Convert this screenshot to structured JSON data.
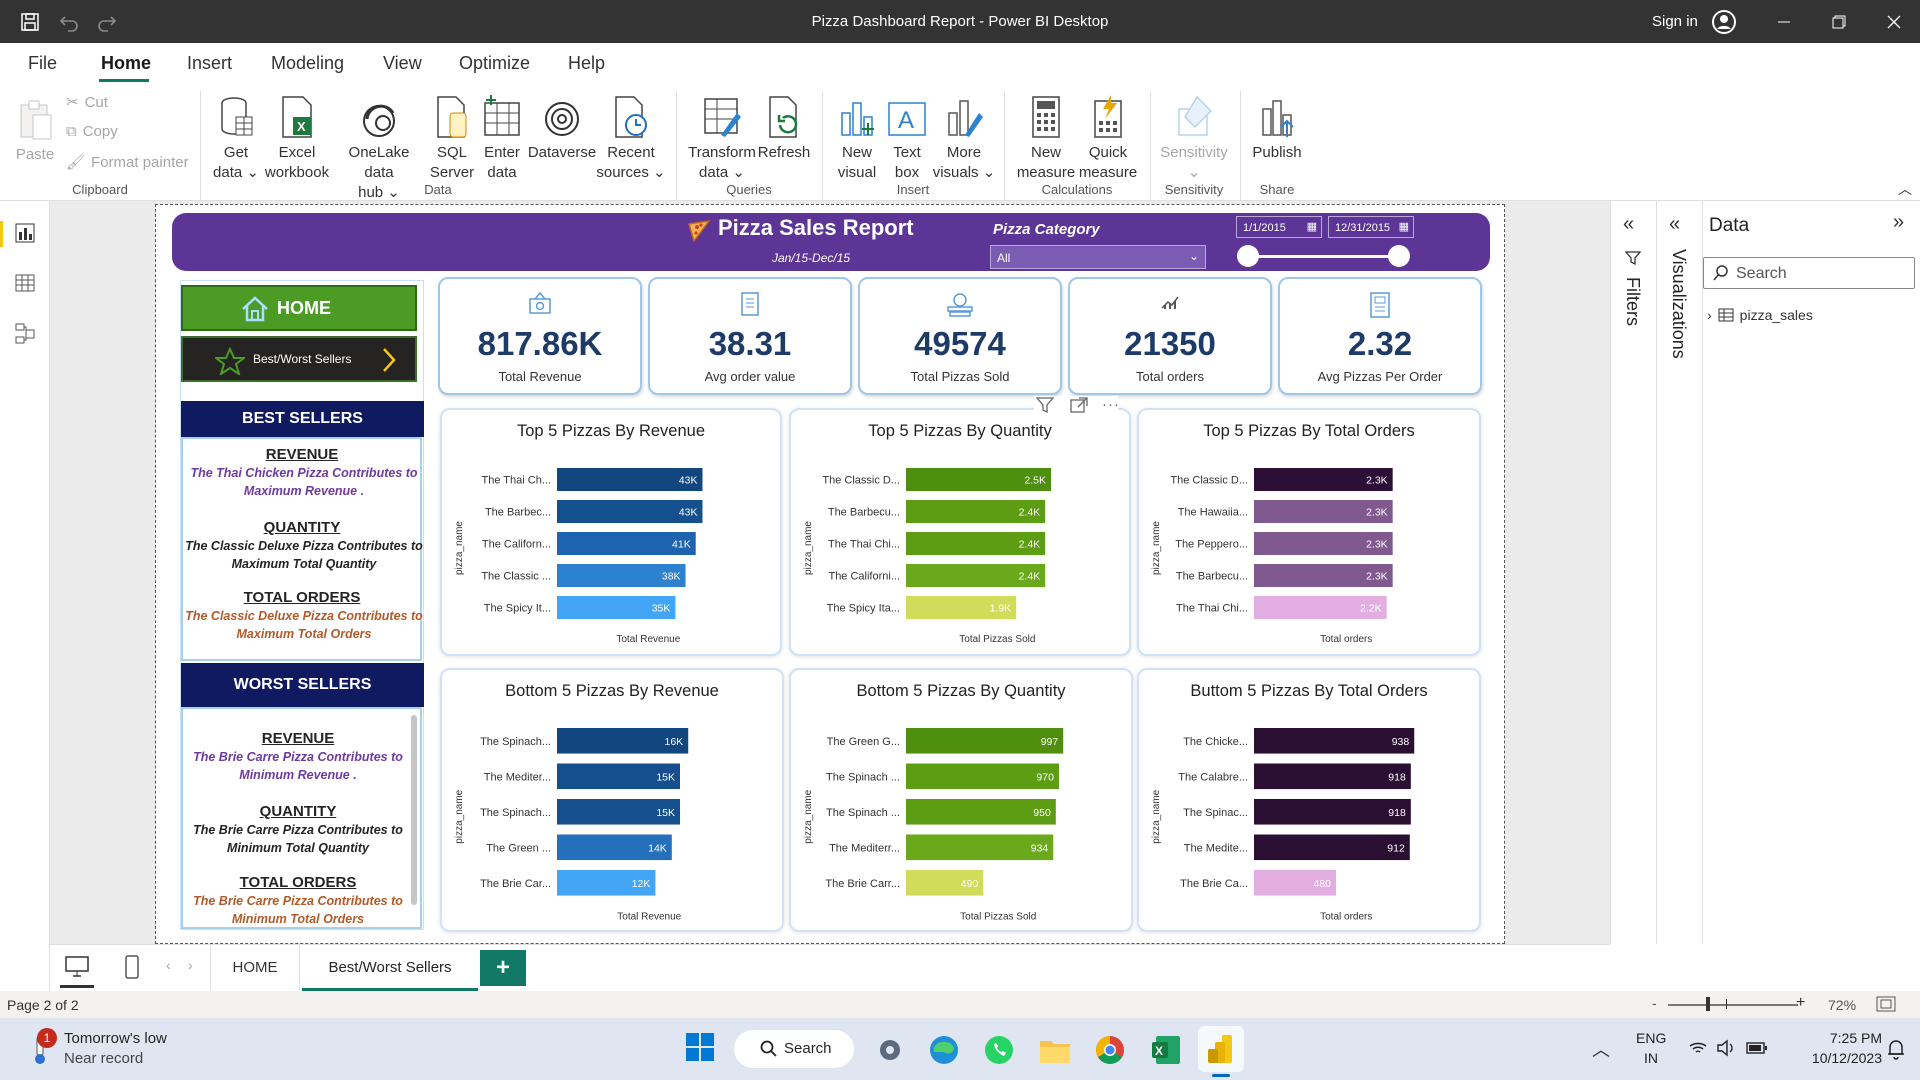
{
  "window": {
    "title": "Pizza Dashboard Report - Power BI Desktop",
    "sign_in": "Sign in"
  },
  "menu": [
    "File",
    "Home",
    "Insert",
    "Modeling",
    "View",
    "Optimize",
    "Help"
  ],
  "ribbon": {
    "clipboard": {
      "paste": "Paste",
      "cut": "Cut",
      "copy": "Copy",
      "format_painter": "Format painter",
      "group": "Clipboard"
    },
    "data": {
      "get_data": [
        "Get",
        "data"
      ],
      "excel": [
        "Excel",
        "workbook"
      ],
      "onelake": [
        "OneLake data",
        "hub"
      ],
      "sql": [
        "SQL",
        "Server"
      ],
      "enter": [
        "Enter",
        "data"
      ],
      "dataverse": "Dataverse",
      "recent": [
        "Recent",
        "sources"
      ],
      "group": "Data"
    },
    "queries": {
      "transform": [
        "Transform",
        "data"
      ],
      "refresh": "Refresh",
      "group": "Queries"
    },
    "insert": {
      "new_visual": [
        "New",
        "visual"
      ],
      "text_box": [
        "Text",
        "box"
      ],
      "more_visuals": [
        "More",
        "visuals"
      ],
      "group": "Insert"
    },
    "calculations": {
      "new_measure": [
        "New",
        "measure"
      ],
      "quick_measure": [
        "Quick",
        "measure"
      ],
      "group": "Calculations"
    },
    "sensitivity": {
      "label": "Sensitivity",
      "group": "Sensitivity"
    },
    "share": {
      "publish": "Publish",
      "group": "Share"
    }
  },
  "report": {
    "title": "Pizza Sales Report",
    "subtitle": "Jan/15-Dec/15",
    "slicer_label": "Pizza Category",
    "slicer_value": "All",
    "date_start": "1/1/2015",
    "date_end": "12/31/2015"
  },
  "nav": {
    "home": "HOME",
    "best_worst": "Best/Worst Sellers"
  },
  "best": {
    "header": "BEST SELLERS",
    "rev_h": "REVENUE",
    "rev_t": "The Thai Chicken Pizza Contributes to Maximum Revenue .",
    "qty_h": "QUANTITY",
    "qty_t": "The Classic Deluxe Pizza  Contributes to Maximum Total Quantity",
    "ord_h": "TOTAL ORDERS",
    "ord_t": "The Classic Deluxe Pizza  Contributes to Maximum Total Orders"
  },
  "worst": {
    "header": "WORST SELLERS",
    "rev_h": "REVENUE",
    "rev_t": "The Brie  Carre Pizza Contributes to Minimum Revenue .",
    "qty_h": "QUANTITY",
    "qty_t": "The Brie Carre Pizza  Contributes to Minimum Total Quantity",
    "ord_h": "TOTAL ORDERS",
    "ord_t": "The Brie Carre Pizza  Contributes to Minimum Total Orders"
  },
  "kpis": [
    {
      "value": "817.86K",
      "label": "Total Revenue"
    },
    {
      "value": "38.31",
      "label": "Avg order value"
    },
    {
      "value": "49574",
      "label": "Total Pizzas Sold"
    },
    {
      "value": "21350",
      "label": "Total orders"
    },
    {
      "value": "2.32",
      "label": "Avg Pizzas Per Order"
    }
  ],
  "chart_data": [
    {
      "type": "bar",
      "title": "Top 5 Pizzas By Revenue",
      "ylabel": "pizza_name",
      "xlabel": "Total Revenue",
      "categories": [
        "The Thai Ch...",
        "The Barbec...",
        "The Californ...",
        "The Classic ...",
        "The Spicy It..."
      ],
      "values": [
        43,
        43,
        41,
        38,
        35
      ],
      "labels": [
        "43K",
        "43K",
        "41K",
        "38K",
        "35K"
      ],
      "xlim": [
        0,
        60
      ],
      "colors": [
        "#12467f",
        "#164f8e",
        "#1d63ad",
        "#2d81cf",
        "#42a5f5"
      ]
    },
    {
      "type": "bar",
      "title": "Top 5 Pizzas By Quantity",
      "ylabel": "pizza_name",
      "xlabel": "Total Pizzas Sold",
      "categories": [
        "The Classic D...",
        "The Barbecu...",
        "The Thai Chi...",
        "The Californi...",
        "The Spicy Ita..."
      ],
      "values": [
        2.5,
        2.4,
        2.4,
        2.4,
        1.9
      ],
      "labels": [
        "2.5K",
        "2.4K",
        "2.4K",
        "2.4K",
        "1.9K"
      ],
      "xlim": [
        0,
        3.5
      ],
      "colors": [
        "#4e8f0f",
        "#5c9d14",
        "#5c9d14",
        "#6aa81c",
        "#d0dc5a"
      ]
    },
    {
      "type": "bar",
      "title": "Top 5 Pizzas By Total Orders",
      "ylabel": "pizza_name",
      "xlabel": "Total orders",
      "categories": [
        "The Classic D...",
        "The Hawaiia...",
        "The Pepperо...",
        "The Barbecu...",
        "The Thai Chi..."
      ],
      "values": [
        2.3,
        2.3,
        2.3,
        2.3,
        2.2
      ],
      "labels": [
        "2.3K",
        "2.3K",
        "2.3K",
        "2.3K",
        "2.2K"
      ],
      "xlim": [
        0,
        3.4
      ],
      "colors": [
        "#2c0f37",
        "#805a8f",
        "#805a8f",
        "#805a8f",
        "#e2ade0"
      ]
    },
    {
      "type": "bar",
      "title": "Bottom 5 Pizzas By Revenue",
      "ylabel": "pizza_name",
      "xlabel": "Total Revenue",
      "categories": [
        "The Spinach...",
        "The Mediter...",
        "The Spinach...",
        "The Green ...",
        "The Brie Car..."
      ],
      "values": [
        16,
        15,
        15,
        14,
        12
      ],
      "labels": [
        "16K",
        "15K",
        "15K",
        "14K",
        "12K"
      ],
      "xlim": [
        0,
        25
      ],
      "colors": [
        "#12467f",
        "#164f8e",
        "#164f8e",
        "#2470bd",
        "#42a5f5"
      ]
    },
    {
      "type": "bar",
      "title": "Bottom 5 Pizzas By Quantity",
      "ylabel": "pizza_name",
      "xlabel": "Total Pizzas Sold",
      "categories": [
        "The Green G...",
        "The Spinach ...",
        "The Spinach ...",
        "The Mediterr...",
        "The Brie Carr..."
      ],
      "values": [
        997,
        970,
        950,
        934,
        490
      ],
      "labels": [
        "997",
        "970",
        "950",
        "934",
        "490"
      ],
      "xlim": [
        0,
        1300
      ],
      "colors": [
        "#4e8f0f",
        "#5c9d14",
        "#5c9d14",
        "#6aa81c",
        "#d0dc5a"
      ]
    },
    {
      "type": "bar",
      "title": "Buttom 5 Pizzas By Total Orders",
      "ylabel": "pizza_name",
      "xlabel": "Total orders",
      "categories": [
        "The Chicke...",
        "The Calabre...",
        "The Spinac...",
        "The Medite...",
        "The Brie Ca..."
      ],
      "values": [
        938,
        918,
        918,
        912,
        480
      ],
      "labels": [
        "938",
        "918",
        "918",
        "912",
        "480"
      ],
      "xlim": [
        0,
        1200
      ],
      "colors": [
        "#2a0f33",
        "#2a0f33",
        "#2a0f33",
        "#2a0f33",
        "#e2ade0"
      ]
    }
  ],
  "panes": {
    "filters": "Filters",
    "visualizations": "Visualizations",
    "data": "Data",
    "search_placeholder": "Search",
    "table": "pizza_sales"
  },
  "tabs": [
    "HOME",
    "Best/Worst Sellers"
  ],
  "status": {
    "page": "Page 2 of 2",
    "zoom": "72%"
  },
  "taskbar": {
    "weather_title": "Tomorrow's low",
    "weather_sub": "Near record",
    "search": "Search",
    "lang1": "ENG",
    "lang2": "IN",
    "time": "7:25 PM",
    "date": "10/12/2023",
    "badge": "1"
  }
}
